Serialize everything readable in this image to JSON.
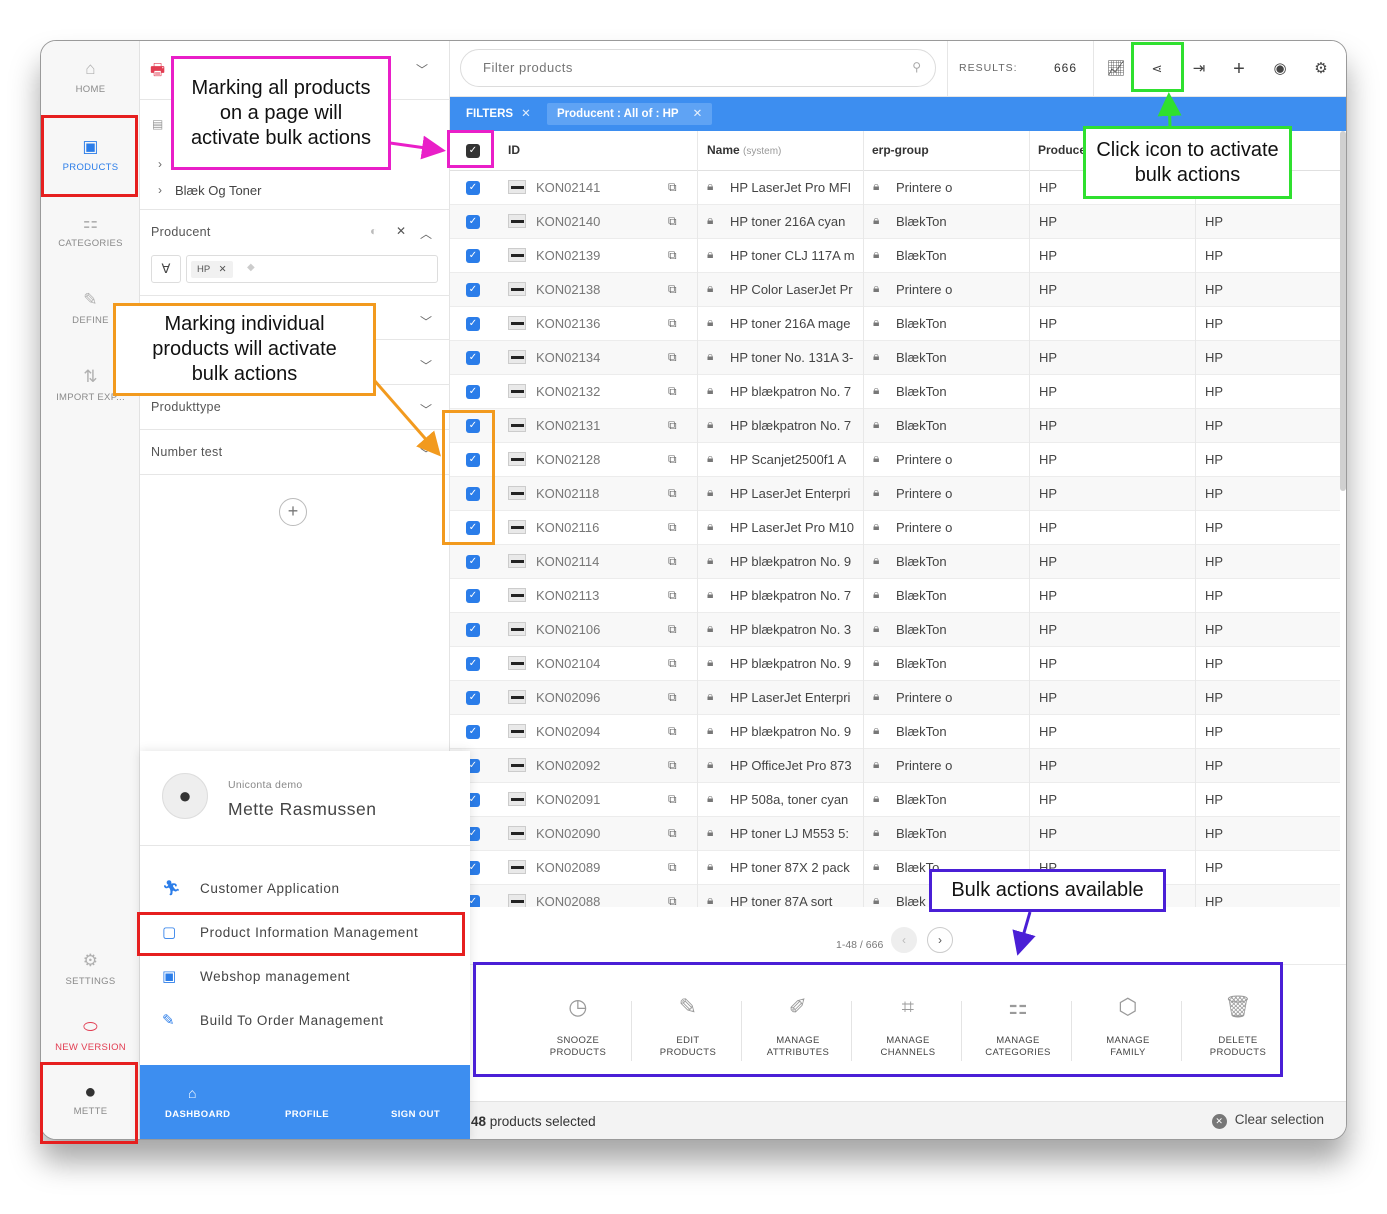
{
  "nav": {
    "home": "HOME",
    "products": "PRODUCTS",
    "categories": "CATEGORIES",
    "define": "DEFINE",
    "import_export": "IMPORT EXP...",
    "settings": "SETTINGS",
    "new_version": "NEW VERSION",
    "user": "METTE"
  },
  "filters_panel": {
    "category_item": "Blæk Og Toner",
    "producent_label": "Producent",
    "producent_operator": "∀",
    "producent_tag": "HP",
    "produkttype_label": "Produkttype",
    "number_test_label": "Number test",
    "add_icon": "+"
  },
  "toolbar": {
    "search_placeholder": "Filter products",
    "results_label": "RESULTS:",
    "results_count": "666"
  },
  "filterbar": {
    "filters_label": "FILTERS",
    "active_filter": "Producent : All of : HP"
  },
  "grid": {
    "headers": {
      "id": "ID",
      "name": "Name",
      "name_note": "(system)",
      "erp_group": "erp-group",
      "producent": "Producent"
    },
    "rows": [
      {
        "id": "KON02141",
        "name": "HP LaserJet Pro MFI",
        "erp": "Printere o",
        "prod": "HP",
        "prod2": ""
      },
      {
        "id": "KON02140",
        "name": "HP toner 216A cyan",
        "erp": "BlækTon",
        "prod": "HP",
        "prod2": "HP"
      },
      {
        "id": "KON02139",
        "name": "HP toner CLJ 117A m",
        "erp": "BlækTon",
        "prod": "HP",
        "prod2": "HP"
      },
      {
        "id": "KON02138",
        "name": "HP Color LaserJet Pr",
        "erp": "Printere o",
        "prod": "HP",
        "prod2": "HP"
      },
      {
        "id": "KON02136",
        "name": "HP toner 216A mage",
        "erp": "BlækTon",
        "prod": "HP",
        "prod2": "HP"
      },
      {
        "id": "KON02134",
        "name": "HP toner No. 131A 3-",
        "erp": "BlækTon",
        "prod": "HP",
        "prod2": "HP"
      },
      {
        "id": "KON02132",
        "name": "HP blækpatron No. 7",
        "erp": "BlækTon",
        "prod": "HP",
        "prod2": "HP"
      },
      {
        "id": "KON02131",
        "name": "HP blækpatron No. 7",
        "erp": "BlækTon",
        "prod": "HP",
        "prod2": "HP"
      },
      {
        "id": "KON02128",
        "name": "HP Scanjet2500f1 A",
        "erp": "Printere o",
        "prod": "HP",
        "prod2": "HP"
      },
      {
        "id": "KON02118",
        "name": "HP LaserJet Enterpri",
        "erp": "Printere o",
        "prod": "HP",
        "prod2": "HP"
      },
      {
        "id": "KON02116",
        "name": "HP LaserJet Pro M10",
        "erp": "Printere o",
        "prod": "HP",
        "prod2": "HP"
      },
      {
        "id": "KON02114",
        "name": "HP blækpatron No. 9",
        "erp": "BlækTon",
        "prod": "HP",
        "prod2": "HP"
      },
      {
        "id": "KON02113",
        "name": "HP blækpatron No. 7",
        "erp": "BlækTon",
        "prod": "HP",
        "prod2": "HP"
      },
      {
        "id": "KON02106",
        "name": "HP blækpatron No. 3",
        "erp": "BlækTon",
        "prod": "HP",
        "prod2": "HP"
      },
      {
        "id": "KON02104",
        "name": "HP blækpatron No. 9",
        "erp": "BlækTon",
        "prod": "HP",
        "prod2": "HP"
      },
      {
        "id": "KON02096",
        "name": "HP LaserJet Enterpri",
        "erp": "Printere o",
        "prod": "HP",
        "prod2": "HP"
      },
      {
        "id": "KON02094",
        "name": "HP blækpatron No. 9",
        "erp": "BlækTon",
        "prod": "HP",
        "prod2": "HP"
      },
      {
        "id": "KON02092",
        "name": "HP OfficeJet Pro 873",
        "erp": "Printere o",
        "prod": "HP",
        "prod2": "HP"
      },
      {
        "id": "KON02091",
        "name": "HP 508a, toner cyan",
        "erp": "BlækTon",
        "prod": "HP",
        "prod2": "HP"
      },
      {
        "id": "KON02090",
        "name": "HP toner LJ M553 5:",
        "erp": "BlækTon",
        "prod": "HP",
        "prod2": "HP"
      },
      {
        "id": "KON02089",
        "name": "HP toner 87X 2 pack",
        "erp": "BlækTo",
        "prod": "HP",
        "prod2": "HP"
      },
      {
        "id": "KON02088",
        "name": "HP toner 87A sort",
        "erp": "Blæk",
        "prod": "",
        "prod2": "HP"
      }
    ]
  },
  "pagination": {
    "label": "1-48 / 666"
  },
  "bulk_actions": [
    {
      "line1": "SNOOZE",
      "line2": "PRODUCTS",
      "icon": "clock-icon"
    },
    {
      "line1": "EDIT",
      "line2": "PRODUCTS",
      "icon": "pencil-icon"
    },
    {
      "line1": "MANAGE",
      "line2": "ATTRIBUTES",
      "icon": "attributes-icon"
    },
    {
      "line1": "MANAGE",
      "line2": "CHANNELS",
      "icon": "channels-icon"
    },
    {
      "line1": "MANAGE",
      "line2": "CATEGORIES",
      "icon": "categories-icon"
    },
    {
      "line1": "MANAGE",
      "line2": "FAMILY",
      "icon": "family-icon"
    },
    {
      "line1": "DELETE",
      "line2": "PRODUCTS",
      "icon": "trash-icon"
    }
  ],
  "selection": {
    "count_bold": "48",
    "count_text": "products selected",
    "clear": "Clear selection"
  },
  "profile": {
    "company": "Uniconta demo",
    "name": "Mette Rasmussen",
    "menu": [
      "Customer Application",
      "Product Information Management",
      "Webshop management",
      "Build To Order Management"
    ],
    "footer": {
      "dashboard": "DASHBOARD",
      "profile": "PROFILE",
      "signout": "SIGN OUT"
    }
  },
  "callouts": {
    "all_products": "Marking all products on a page will activate bulk actions",
    "individual": "Marking individual products will activate bulk actions",
    "click_icon": "Click icon to activate bulk actions",
    "bulk_available": "Bulk actions available"
  },
  "colors": {
    "accent": "#3d8ef0",
    "magenta": "#e91fc8",
    "orange": "#f29a1e",
    "green": "#2fe02f",
    "purple": "#4a1fd6",
    "red": "#e61f1f"
  }
}
